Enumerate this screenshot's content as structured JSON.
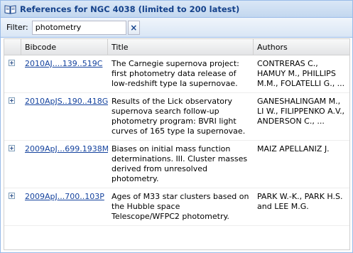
{
  "panel": {
    "title": "References for NGC 4038 (limited to 200 latest)",
    "icon": "book-icon"
  },
  "filter": {
    "label": "Filter:",
    "value": "photometry",
    "clear_icon": "close-icon",
    "clear_glyph": "×"
  },
  "grid": {
    "columns": [
      "Bibcode",
      "Title",
      "Authors"
    ],
    "rows": [
      {
        "bibcode": "2010AJ....139..519C",
        "title": "The Carnegie supernova project: first photometry data release of low-redshift type Ia supernovae.",
        "authors": "CONTRERAS C., HAMUY M., PHILLIPS M.M., FOLATELLI G., ..."
      },
      {
        "bibcode": "2010ApJS..190..418G",
        "title": "Results of the Lick observatory supernova search follow-up photometry program: BVRI light curves of 165 type Ia supernovae.",
        "authors": "GANESHALINGAM M., LI W., FILIPPENKO A.V., ANDERSON C., ..."
      },
      {
        "bibcode": "2009ApJ...699.1938M",
        "title": "Biases on initial mass function determinations. III. Cluster masses derived from unresolved photometry.",
        "authors": "MAIZ APELLANIZ J."
      },
      {
        "bibcode": "2009ApJ...700..103P",
        "title": "Ages of M33 star clusters based on the Hubble space Telescope/WFPC2 photometry.",
        "authors": "PARK W.-K., PARK H.S. and LEE M.G."
      }
    ]
  }
}
